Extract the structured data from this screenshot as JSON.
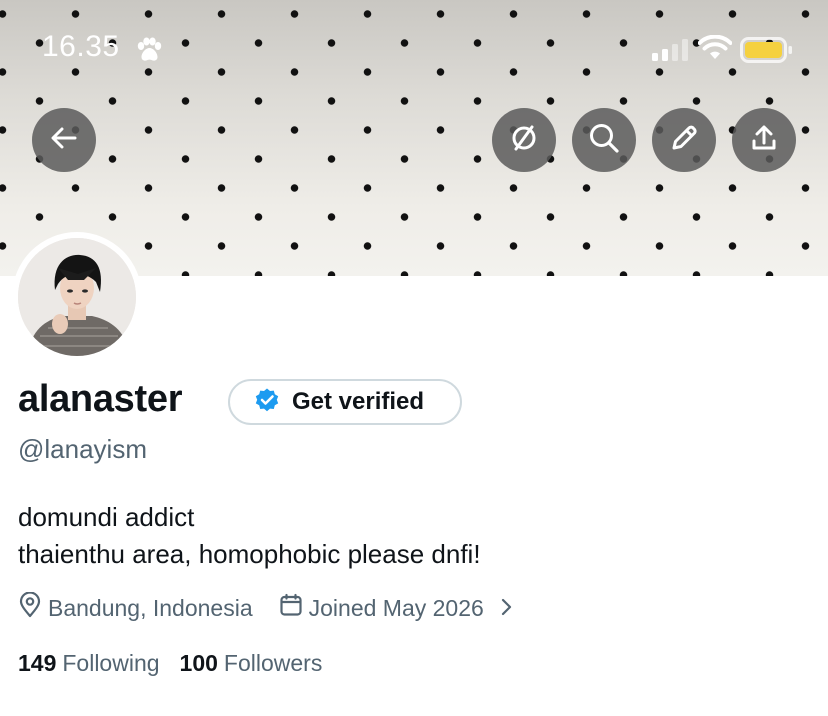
{
  "status_bar": {
    "time": "16.35",
    "icons": [
      "paw-icon",
      "signal-icon",
      "wifi-icon",
      "battery-icon"
    ],
    "battery_color": "#f5d13f"
  },
  "header": {
    "buttons": [
      "back-arrow-icon",
      "translate-icon",
      "search-icon",
      "edit-pencil-icon",
      "share-upload-icon"
    ],
    "button_bg": "#5a5a5a"
  },
  "profile": {
    "display_name": "alanaster",
    "verify_label": "Get verified",
    "verify_badge_color": "#1d9bf0",
    "handle": "@lanayism",
    "bio_lines": [
      "domundi addict",
      "thaienthu area, homophobic please dnfi!"
    ],
    "location": "Bandung, Indonesia",
    "joined": "Joined May 2026",
    "following_count": "149",
    "following_label": "Following",
    "followers_count": "100",
    "followers_label": "Followers"
  }
}
